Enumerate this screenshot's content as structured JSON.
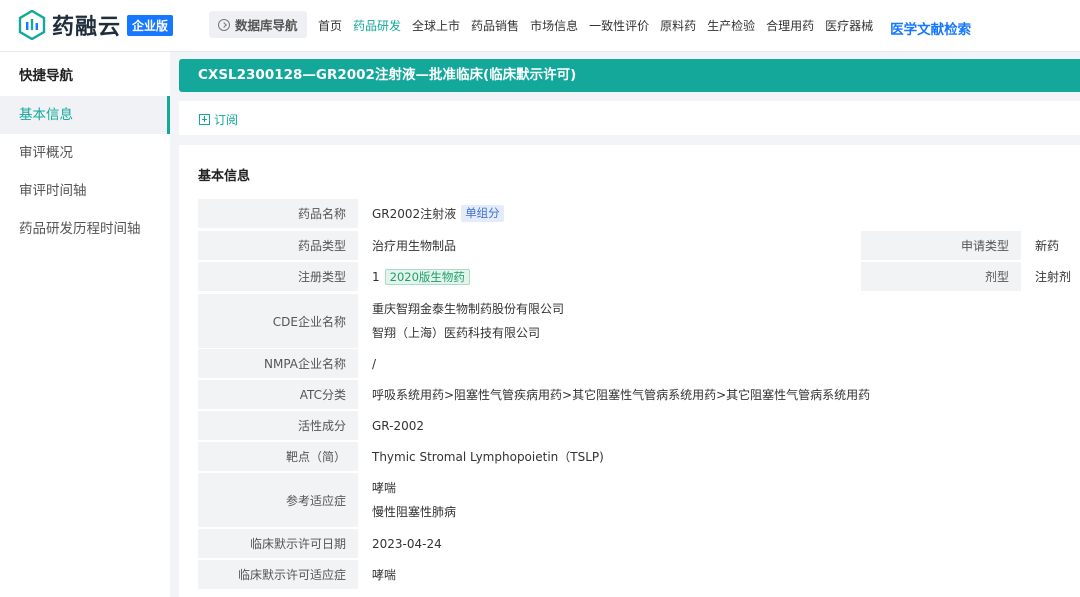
{
  "app": {
    "logo_text": "药融云",
    "edition_badge": "企业版",
    "db_nav_label": "数据库导航",
    "menu": [
      {
        "label": "首页"
      },
      {
        "label": "药品研发"
      },
      {
        "label": "全球上市"
      },
      {
        "label": "药品销售"
      },
      {
        "label": "市场信息"
      },
      {
        "label": "一致性评价"
      },
      {
        "label": "原料药"
      },
      {
        "label": "生产检验"
      },
      {
        "label": "合理用药"
      },
      {
        "label": "医疗器械"
      },
      {
        "label": "医学文献检索"
      }
    ],
    "active_menu": "药品研发",
    "accent_color": "#14a89b",
    "brand_color": "#1677ff"
  },
  "sidebar": {
    "title": "快捷导航",
    "items": [
      {
        "label": "基本信息"
      },
      {
        "label": "审评概况"
      },
      {
        "label": "审评时间轴"
      },
      {
        "label": "药品研发历程时间轴"
      }
    ]
  },
  "header": {
    "title": "CXSL2300128—GR2002注射液—批准临床(临床默示许可)",
    "subscribe_label": "订阅"
  },
  "basic_info": {
    "section_title": "基本信息",
    "drug_name": {
      "label": "药品名称",
      "value": "GR2002注射液",
      "tag": "单组分"
    },
    "drug_type": {
      "label": "药品类型",
      "value": "治疗用生物制品"
    },
    "apply_type": {
      "label": "申请类型",
      "value": "新药"
    },
    "reg_type": {
      "label": "注册类型",
      "value": "1",
      "tag": "2020版生物药"
    },
    "dosage_form": {
      "label": "剂型",
      "value": "注射剂"
    },
    "cde_company": {
      "label": "CDE企业名称",
      "values": [
        "重庆智翔金泰生物制药股份有限公司",
        "智翔（上海）医药科技有限公司"
      ]
    },
    "nmpa_company": {
      "label": "NMPA企业名称",
      "value": "/"
    },
    "atc": {
      "label": "ATC分类",
      "value": "呼吸系统用药>阻塞性气管疾病用药>其它阻塞性气管病系统用药>其它阻塞性气管病系统用药"
    },
    "active_ingredient": {
      "label": "活性成分",
      "value": "GR-2002"
    },
    "target": {
      "label": "靶点（简）",
      "value": "Thymic Stromal Lymphopoietin（TSLP)"
    },
    "indications": {
      "label": "参考适应症",
      "values": [
        "哮喘",
        "慢性阻塞性肺病"
      ]
    },
    "approval_date": {
      "label": "临床默示许可日期",
      "value": "2023-04-24"
    },
    "approval_indication": {
      "label": "临床默示许可适应症",
      "value": "哮喘"
    }
  }
}
